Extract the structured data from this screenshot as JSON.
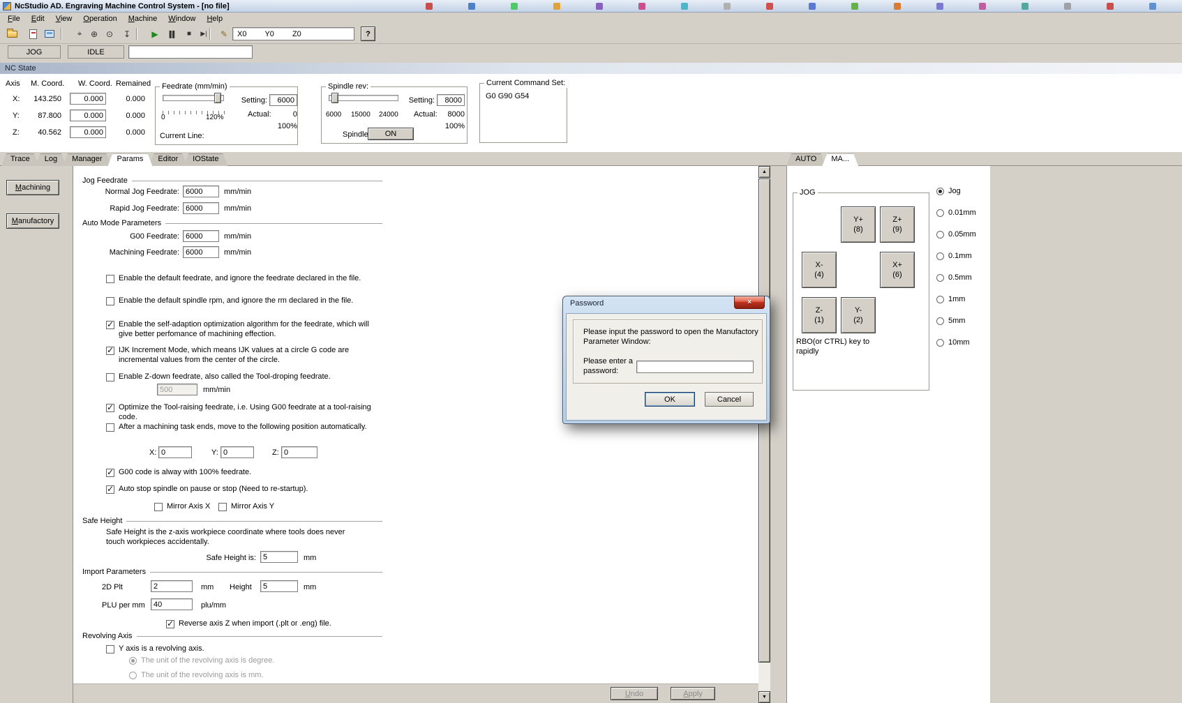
{
  "titlebar": {
    "title": "NcStudio AD. Engraving Machine Control System - [no file]"
  },
  "menubar": {
    "items": [
      "File",
      "Edit",
      "View",
      "Operation",
      "Machine",
      "Window",
      "Help"
    ]
  },
  "toolbar": {
    "coords": [
      "X0",
      "Y0",
      "Z0"
    ],
    "help": "?",
    "icons": [
      {
        "name": "goto-origin-icon",
        "glyph": "⌖"
      },
      {
        "name": "set-origin-icon",
        "glyph": "⊕"
      },
      {
        "name": "back-to-origin-icon",
        "glyph": "⊙"
      },
      {
        "name": "datum-icon",
        "glyph": "↧"
      },
      {
        "name": "start-icon",
        "glyph": "▶"
      },
      {
        "name": "pause-icon",
        "glyph": "▌▌"
      },
      {
        "name": "stop-icon",
        "glyph": "■"
      },
      {
        "name": "step-icon",
        "glyph": "▶|"
      },
      {
        "name": "edit-icon",
        "glyph": "✎"
      }
    ]
  },
  "status": {
    "mode": "JOG",
    "state": "IDLE"
  },
  "nc_state": {
    "label": "NC State"
  },
  "coords": {
    "headers": [
      "Axis",
      "M. Coord.",
      "W. Coord.",
      "Remained"
    ],
    "rows": [
      {
        "axis": "X:",
        "m": "143.250",
        "w": "0.000",
        "rem": "0.000"
      },
      {
        "axis": "Y:",
        "m": "87.800",
        "w": "0.000",
        "rem": "0.000"
      },
      {
        "axis": "Z:",
        "m": "40.562",
        "w": "0.000",
        "rem": "0.000"
      }
    ]
  },
  "feedrate": {
    "title": "Feedrate (mm/min)",
    "setting_label": "Setting:",
    "setting_value": "6000",
    "actual_label": "Actual:",
    "actual_value": "0",
    "scale_left": "0",
    "scale_right": "120%",
    "percent": "100%",
    "current_line_label": "Current Line:"
  },
  "spindle": {
    "title": "Spindle rev:",
    "ticks": [
      "6000",
      "15000",
      "24000"
    ],
    "setting_label": "Setting:",
    "setting_value": "8000",
    "actual_label": "Actual:",
    "actual_value": "8000",
    "percent": "100%",
    "label": "Spindle:",
    "state": "ON"
  },
  "command_set": {
    "title": "Current Command Set:",
    "value": "G0 G90 G54"
  },
  "tabs": {
    "left": [
      "Trace",
      "Log",
      "Manager",
      "Params",
      "Editor",
      "IOState"
    ],
    "active_left": "Params",
    "right": [
      "AUTO",
      "MA..."
    ],
    "active_right": "MA..."
  },
  "side": {
    "buttons": [
      "Machining",
      "Manufactory"
    ]
  },
  "params": {
    "sections": [
      "Jog Feedrate",
      "Auto Mode Parameters",
      "Safe Height",
      "Import Parameters",
      "Revolving Axis"
    ],
    "fields": [
      {
        "label": "Normal Jog Feedrate:",
        "value": "6000",
        "unit": "mm/min"
      },
      {
        "label": "Rapid Jog Feedrate:",
        "value": "6000",
        "unit": "mm/min"
      },
      {
        "label": "G00 Feedrate:",
        "value": "6000",
        "unit": "mm/min"
      },
      {
        "label": "Machining Feedrate:",
        "value": "6000",
        "unit": "mm/min"
      }
    ],
    "checks": [
      {
        "label": "Enable the default feedrate, and ignore the feedrate declared in the file.",
        "checked": false
      },
      {
        "label": "Enable the default spindle rpm, and ignore the rm declared in the file.",
        "checked": false
      },
      {
        "label": "Enable the self-adaption optimization algorithm for the feedrate, which will give better perfomance of machining effection.",
        "checked": true
      },
      {
        "label": "IJK Increment Mode, which means IJK values at a circle G code are incremental values from the center of the circle.",
        "checked": true
      },
      {
        "label": "Enable Z-down feedrate, also called the Tool-droping feedrate.",
        "checked": false
      },
      {
        "label": "Optimize the Tool-raising feedrate, i.e. Using G00 feedrate at a tool-raising code.",
        "checked": true
      },
      {
        "label": "After a machining task ends, move to the following position automatically.",
        "checked": false
      },
      {
        "label": "G00 code is alway with 100% feedrate.",
        "checked": true
      },
      {
        "label": "Auto stop spindle on pause or stop (Need to re-startup).",
        "checked": true
      },
      {
        "label": "Mirror Axis X",
        "checked": false
      },
      {
        "label": "Mirror Axis Y",
        "checked": false
      },
      {
        "label": "Reverse axis Z when import (.plt or .eng) file.",
        "checked": true
      },
      {
        "label": "Y axis is a revolving axis.",
        "checked": false
      }
    ],
    "zdown": {
      "value": "500",
      "unit": "mm/min"
    },
    "target": {
      "xl": "X:",
      "x": "0",
      "yl": "Y:",
      "y": "0",
      "zl": "Z:",
      "z": "0"
    },
    "safe": {
      "desc": "Safe Height is the z-axis workpiece coordinate where tools does never touch workpieces accidentally.",
      "label": "Safe Height is:",
      "value": "5",
      "unit": "mm"
    },
    "import": {
      "plt": {
        "label": "2D Plt",
        "value": "2",
        "unit": "mm"
      },
      "height": {
        "label": "Height",
        "value": "5",
        "unit": "mm"
      },
      "plu": {
        "label": "PLU per mm",
        "value": "40",
        "unit": "plu/mm"
      }
    },
    "radios": [
      {
        "label": "The unit of the revolving axis is degree.",
        "selected": true
      },
      {
        "label": "The unit of the revolving axis is mm.",
        "selected": false
      }
    ],
    "undo": "Undo",
    "apply": "Apply"
  },
  "jog": {
    "title": "JOG",
    "buttons": [
      {
        "t": "Y+",
        "k": "(8)"
      },
      {
        "t": "Z+",
        "k": "(9)"
      },
      {
        "t": "X-",
        "k": "(4)"
      },
      {
        "t": "X+",
        "k": "(6)"
      },
      {
        "t": "Z-",
        "k": "(1)"
      },
      {
        "t": "Y-",
        "k": "(2)"
      }
    ],
    "note1": "RBO(or CTRL) key to",
    "note2": "rapidly",
    "steps": [
      "Jog",
      "0.01mm",
      "0.05mm",
      "0.1mm",
      "0.5mm",
      "1mm",
      "5mm",
      "10mm"
    ],
    "selected_step": "Jog"
  },
  "scrollbar": {
    "up": "▲",
    "down": "▼"
  },
  "dialog": {
    "title": "Password",
    "close": "×",
    "message": "Please input the password to open the Manufactory Parameter Window:",
    "field_label": "Please enter a password:",
    "value": "",
    "ok": "OK",
    "cancel": "Cancel"
  },
  "colors": {
    "start_button": "#188c18",
    "dialog_close": "#c13520"
  }
}
